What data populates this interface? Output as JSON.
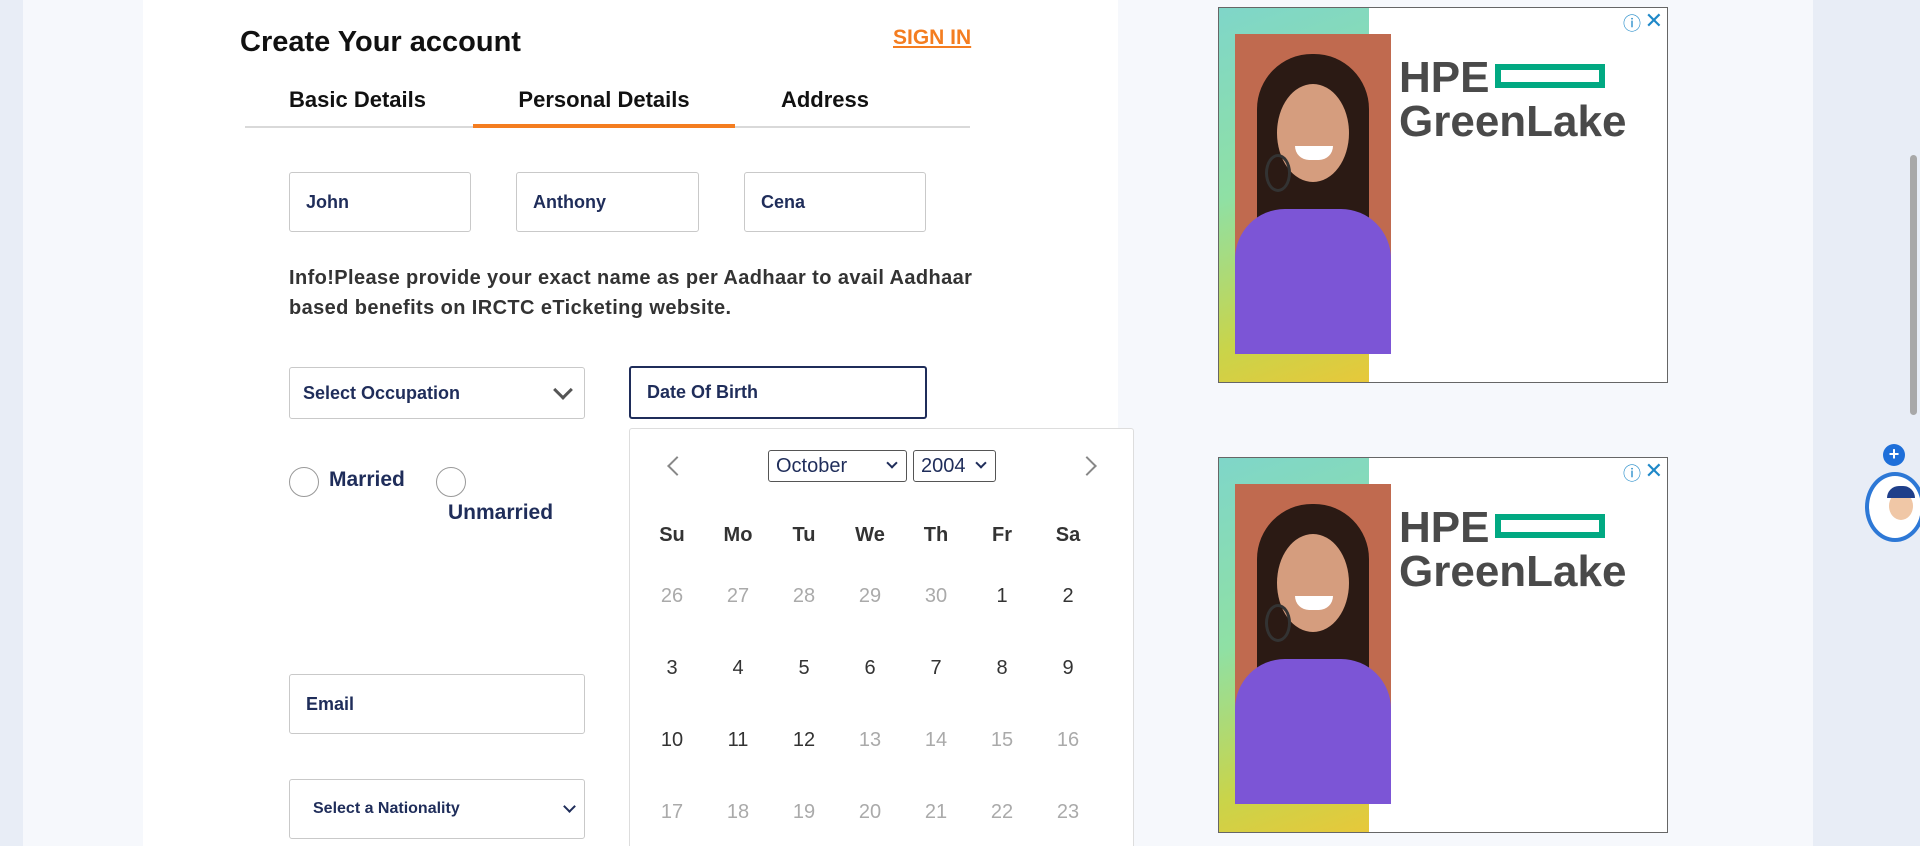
{
  "header": {
    "title": "Create Your account",
    "signin_label": "SIGN IN"
  },
  "tabs": [
    {
      "label": "Basic Details",
      "active": false
    },
    {
      "label": "Personal Details",
      "active": true
    },
    {
      "label": "Address",
      "active": false
    }
  ],
  "name_fields": {
    "first": "John",
    "middle": "Anthony",
    "last": "Cena"
  },
  "info_text": "Info!Please provide your exact name as per Aadhaar to avail Aadhaar based benefits on IRCTC eTicketing website.",
  "occupation_select": {
    "value": "Select Occupation"
  },
  "dob_field": {
    "value": "Date Of Birth"
  },
  "marital": {
    "married_label": "Married",
    "unmarried_label": "Unmarried"
  },
  "email_field": {
    "value": "Email"
  },
  "nationality_select": {
    "value": "Select a Nationality"
  },
  "calendar": {
    "month": "October",
    "year": "2004",
    "weekdays": [
      "Su",
      "Mo",
      "Tu",
      "We",
      "Th",
      "Fr",
      "Sa"
    ],
    "weeks": [
      [
        {
          "d": "26",
          "m": true
        },
        {
          "d": "27",
          "m": true
        },
        {
          "d": "28",
          "m": true
        },
        {
          "d": "29",
          "m": true
        },
        {
          "d": "30",
          "m": true
        },
        {
          "d": "1",
          "m": false
        },
        {
          "d": "2",
          "m": false
        }
      ],
      [
        {
          "d": "3",
          "m": false
        },
        {
          "d": "4",
          "m": false
        },
        {
          "d": "5",
          "m": false
        },
        {
          "d": "6",
          "m": false
        },
        {
          "d": "7",
          "m": false
        },
        {
          "d": "8",
          "m": false
        },
        {
          "d": "9",
          "m": false
        }
      ],
      [
        {
          "d": "10",
          "m": false
        },
        {
          "d": "11",
          "m": false
        },
        {
          "d": "12",
          "m": false
        },
        {
          "d": "13",
          "m": true
        },
        {
          "d": "14",
          "m": true
        },
        {
          "d": "15",
          "m": true
        },
        {
          "d": "16",
          "m": true
        }
      ],
      [
        {
          "d": "17",
          "m": true
        },
        {
          "d": "18",
          "m": true
        },
        {
          "d": "19",
          "m": true
        },
        {
          "d": "20",
          "m": true
        },
        {
          "d": "21",
          "m": true
        },
        {
          "d": "22",
          "m": true
        },
        {
          "d": "23",
          "m": true
        }
      ]
    ]
  },
  "ads": [
    {
      "brand_line1": "HPE",
      "brand_line2": "GreenLake",
      "info_icon": "info-icon",
      "close_icon": "close-icon"
    },
    {
      "brand_line1": "HPE",
      "brand_line2": "GreenLake",
      "info_icon": "info-icon",
      "close_icon": "close-icon"
    }
  ],
  "colors": {
    "accent": "#f47d20",
    "text_navy": "#1f2d5a",
    "ad_link": "#1e88c8"
  }
}
